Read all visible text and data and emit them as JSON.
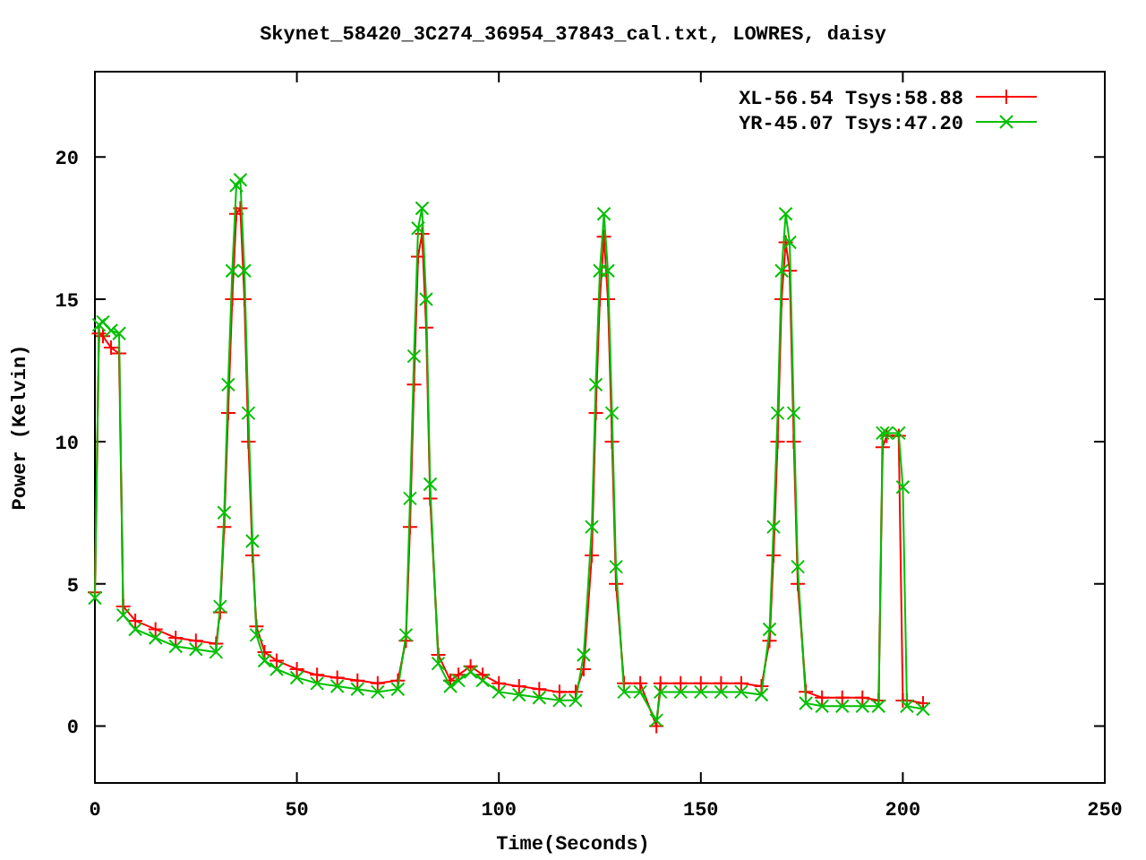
{
  "chart_data": {
    "type": "line",
    "title": "Skynet_58420_3C274_36954_37843_cal.txt, LOWRES, daisy",
    "xlabel": "Time(Seconds)",
    "ylabel": "Power (Kelvin)",
    "x": [
      0,
      1,
      2,
      4,
      6,
      7,
      10,
      15,
      20,
      25,
      30,
      31,
      32,
      33,
      34,
      35,
      36,
      37,
      38,
      39,
      40,
      42,
      45,
      50,
      55,
      60,
      65,
      70,
      75,
      77,
      78,
      79,
      80,
      81,
      82,
      83,
      85,
      88,
      90,
      93,
      96,
      100,
      105,
      110,
      115,
      119,
      121,
      123,
      124,
      125,
      126,
      127,
      128,
      129,
      131,
      135,
      139,
      140,
      145,
      150,
      155,
      160,
      165,
      167,
      168,
      169,
      170,
      171,
      172,
      173,
      174,
      176,
      180,
      185,
      190,
      194,
      195,
      196,
      199,
      200,
      201,
      205
    ],
    "series": [
      {
        "name": "XL-56.54 Tsys:58.88",
        "color": "#ff0000",
        "marker": "plus",
        "values": [
          4.7,
          13.8,
          13.7,
          13.3,
          13.1,
          4.2,
          3.7,
          3.4,
          3.1,
          3.0,
          2.9,
          4,
          7,
          11,
          15,
          18,
          18.2,
          15,
          10,
          6,
          3.5,
          2.6,
          2.3,
          2.0,
          1.8,
          1.7,
          1.6,
          1.5,
          1.6,
          3,
          7,
          12,
          16.5,
          17.3,
          14,
          8,
          2.5,
          1.6,
          1.8,
          2.1,
          1.8,
          1.5,
          1.4,
          1.3,
          1.2,
          1.2,
          2,
          6,
          11,
          15,
          17.2,
          15,
          10,
          5,
          1.5,
          1.5,
          0,
          1.5,
          1.5,
          1.5,
          1.5,
          1.5,
          1.4,
          3,
          6,
          10,
          15,
          17,
          16,
          10,
          5,
          1.2,
          1.0,
          1.0,
          1.0,
          0.9,
          9.8,
          10.2,
          10.2,
          0.9,
          0.9,
          0.8
        ]
      },
      {
        "name": "YR-45.07 Tsys:47.20",
        "color": "#00c000",
        "marker": "cross",
        "values": [
          4.5,
          14.1,
          14.2,
          13.9,
          13.8,
          3.9,
          3.4,
          3.1,
          2.8,
          2.7,
          2.6,
          4.2,
          7.5,
          12,
          16,
          19,
          19.2,
          16,
          11,
          6.5,
          3.2,
          2.3,
          2.0,
          1.7,
          1.5,
          1.4,
          1.3,
          1.2,
          1.3,
          3.2,
          8,
          13,
          17.5,
          18.2,
          15,
          8.5,
          2.2,
          1.4,
          1.6,
          1.9,
          1.6,
          1.2,
          1.1,
          1.0,
          0.9,
          0.9,
          2.5,
          7,
          12,
          16,
          18,
          16,
          11,
          5.6,
          1.2,
          1.2,
          0.2,
          1.2,
          1.2,
          1.2,
          1.2,
          1.2,
          1.1,
          3.4,
          7,
          11,
          16,
          18,
          17,
          11,
          5.6,
          0.8,
          0.7,
          0.7,
          0.7,
          0.7,
          10.3,
          10.3,
          10.3,
          8.4,
          0.7,
          0.6
        ]
      }
    ],
    "legend": true,
    "xlim": [
      0,
      250
    ],
    "ylim": [
      -2,
      23
    ],
    "xticks": [
      0,
      50,
      100,
      150,
      200,
      250
    ],
    "yticks": [
      0,
      5,
      10,
      15,
      20
    ]
  }
}
